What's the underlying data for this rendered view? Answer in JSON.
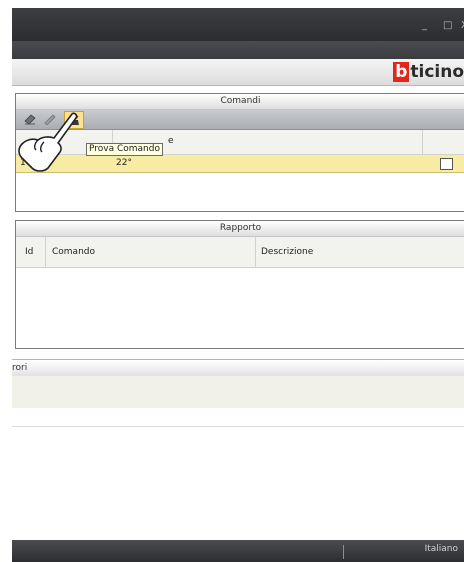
{
  "window": {
    "controls": {
      "minimize": "_",
      "maximize": "□",
      "close": "X"
    }
  },
  "brand": {
    "logo_letter": "b",
    "logo_rest": "ticino"
  },
  "comandi": {
    "title": "Comandi",
    "toolbar": {
      "icons": [
        "eraser-icon",
        "edit-icon",
        "test-command-icon"
      ]
    },
    "tooltip": "Prova Comando",
    "columns": [
      "",
      "e",
      ""
    ],
    "rows": [
      {
        "id": "1",
        "value": "22°",
        "checked": false
      }
    ]
  },
  "rapporto": {
    "title": "Rapporto",
    "columns": {
      "id": "Id",
      "comando": "Comando",
      "descrizione": "Descrizione"
    }
  },
  "errors": {
    "title": "rori"
  },
  "statusbar": {
    "language": "Italiano"
  },
  "colors": {
    "accent": "#e1261c",
    "row_highlight": "#f8eca4",
    "tooltip_bg": "#ffffe1"
  }
}
